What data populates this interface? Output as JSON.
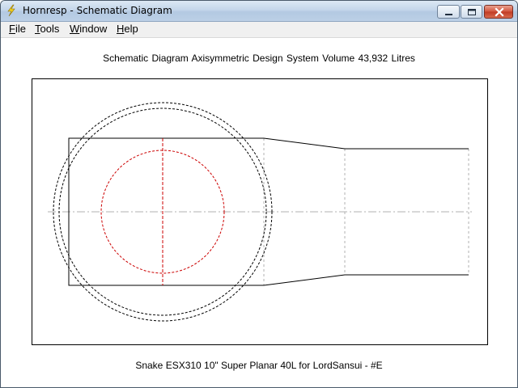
{
  "window": {
    "title": "Hornresp - Schematic Diagram",
    "icon": "lightning-icon",
    "controls": [
      "minimize-icon",
      "maximize-icon",
      "close-icon"
    ]
  },
  "menu": {
    "items": [
      {
        "label": "File",
        "accel": "F"
      },
      {
        "label": "Tools",
        "accel": "T"
      },
      {
        "label": "Window",
        "accel": "W"
      },
      {
        "label": "Help",
        "accel": "H"
      }
    ]
  },
  "diagram": {
    "heading": "Schematic Diagram   Axisymmetric Design   System Volume 43,932 Litres",
    "caption": "Snake ESX310 10\" Super Planar 40L for LordSansui - #E",
    "colors": {
      "outline": "#000000",
      "driver": "#cc0000",
      "guides": "#b0b0b0",
      "frame": "#000000"
    }
  }
}
